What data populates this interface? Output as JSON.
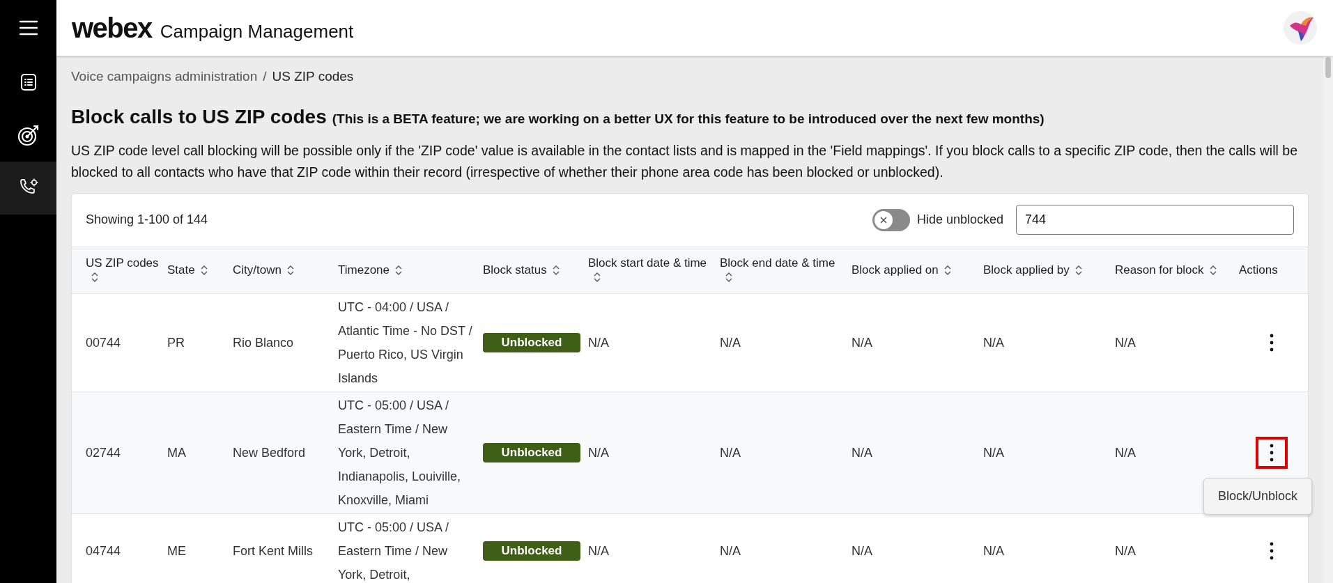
{
  "sidebar": {
    "items": [
      {
        "kind": "menu",
        "selected": false
      },
      {
        "kind": "list",
        "selected": false
      },
      {
        "kind": "target",
        "selected": false
      },
      {
        "kind": "phone",
        "selected": true
      }
    ]
  },
  "header": {
    "logo": "webex",
    "title": "Campaign Management"
  },
  "breadcrumb": {
    "items": [
      "Voice campaigns administration",
      "US ZIP codes"
    ],
    "separator": "/"
  },
  "heading": "Block calls to US ZIP codes",
  "heading_note": "(This is a BETA feature; we are working on a better UX for this feature to be introduced over the next few months)",
  "description": "US ZIP code level call blocking will be possible only if the 'ZIP code' value is available in the contact lists and is mapped in the 'Field mappings'. If you block calls to a specific ZIP code, then the calls will be blocked to all contacts who have that ZIP code within their record (irrespective of whether their phone area code has been blocked or unblocked).",
  "table": {
    "showing": "Showing 1-100 of 144",
    "hide_unblocked": {
      "label": "Hide unblocked",
      "on": false
    },
    "search": {
      "value": "744"
    },
    "columns": [
      {
        "label": "US ZIP codes",
        "sortable": true
      },
      {
        "label": "State",
        "sortable": true
      },
      {
        "label": "City/town",
        "sortable": true
      },
      {
        "label": "Timezone",
        "sortable": true
      },
      {
        "label": "Block status",
        "sortable": true
      },
      {
        "label": "Block start date & time",
        "sortable": true
      },
      {
        "label": "Block end date & time",
        "sortable": true
      },
      {
        "label": "Block applied on",
        "sortable": true
      },
      {
        "label": "Block applied by",
        "sortable": true
      },
      {
        "label": "Reason for block",
        "sortable": true
      },
      {
        "label": "Actions",
        "sortable": false
      }
    ],
    "rows": [
      {
        "zip": "00744",
        "state": "PR",
        "city": "Rio Blanco",
        "timezone": "UTC - 04:00 / USA / Atlantic Time - No DST / Puerto Rico, US Virgin Islands",
        "status": "Unblocked",
        "start": "N/A",
        "end": "N/A",
        "applied_on": "N/A",
        "applied_by": "N/A",
        "reason": "N/A",
        "menu_open": false
      },
      {
        "zip": "02744",
        "state": "MA",
        "city": "New Bedford",
        "timezone": "UTC - 05:00 / USA / Eastern Time / New York, Detroit, Indianapolis, Louiville, Knoxville, Miami",
        "status": "Unblocked",
        "start": "N/A",
        "end": "N/A",
        "applied_on": "N/A",
        "applied_by": "N/A",
        "reason": "N/A",
        "menu_open": true
      },
      {
        "zip": "04744",
        "state": "ME",
        "city": "Fort Kent Mills",
        "timezone": "UTC - 05:00 / USA / Eastern Time / New York, Detroit,",
        "status": "Unblocked",
        "start": "N/A",
        "end": "N/A",
        "applied_on": "N/A",
        "applied_by": "N/A",
        "reason": "N/A",
        "menu_open": false
      }
    ],
    "action_menu": [
      "Block/Unblock"
    ]
  }
}
